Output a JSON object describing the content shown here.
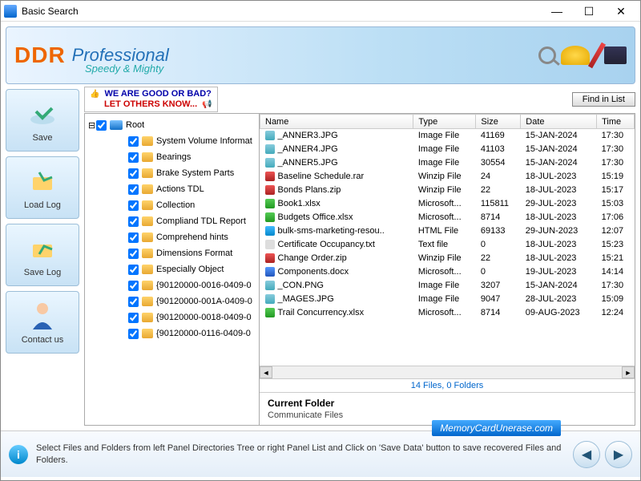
{
  "title": "Basic Search",
  "banner": {
    "brand": "DDR",
    "pro": "Professional",
    "tagline": "Speedy & Mighty"
  },
  "sidebar": [
    {
      "label": "Save"
    },
    {
      "label": "Load Log"
    },
    {
      "label": "Save Log"
    },
    {
      "label": "Contact us"
    }
  ],
  "feedback": {
    "line1": "WE ARE GOOD OR BAD?",
    "line2": "LET OTHERS KNOW..."
  },
  "find_btn": "Find in List",
  "tree": {
    "root": "Root",
    "items": [
      "System Volume Informat",
      "Bearings",
      "Brake System Parts",
      "Actions TDL",
      "Collection",
      "Compliand TDL Report",
      "Comprehend hints",
      "Dimensions Format",
      "Especially Object",
      "{90120000-0016-0409-0",
      "{90120000-001A-0409-0",
      "{90120000-0018-0409-0",
      "{90120000-0116-0409-0"
    ]
  },
  "columns": [
    "Name",
    "Type",
    "Size",
    "Date",
    "Time"
  ],
  "files": [
    {
      "ic": "img",
      "name": "_ANNER3.JPG",
      "type": "Image File",
      "size": "41169",
      "date": "15-JAN-2024",
      "time": "17:30"
    },
    {
      "ic": "img",
      "name": "_ANNER4.JPG",
      "type": "Image File",
      "size": "41103",
      "date": "15-JAN-2024",
      "time": "17:30"
    },
    {
      "ic": "img",
      "name": "_ANNER5.JPG",
      "type": "Image File",
      "size": "30554",
      "date": "15-JAN-2024",
      "time": "17:30"
    },
    {
      "ic": "rar",
      "name": "Baseline Schedule.rar",
      "type": "Winzip File",
      "size": "24",
      "date": "18-JUL-2023",
      "time": "15:19"
    },
    {
      "ic": "zip",
      "name": "Bonds Plans.zip",
      "type": "Winzip File",
      "size": "22",
      "date": "18-JUL-2023",
      "time": "15:17"
    },
    {
      "ic": "xls",
      "name": "Book1.xlsx",
      "type": "Microsoft...",
      "size": "115811",
      "date": "29-JUL-2023",
      "time": "15:03"
    },
    {
      "ic": "xls",
      "name": "Budgets Office.xlsx",
      "type": "Microsoft...",
      "size": "8714",
      "date": "18-JUL-2023",
      "time": "17:06"
    },
    {
      "ic": "html",
      "name": "bulk-sms-marketing-resou..",
      "type": "HTML File",
      "size": "69133",
      "date": "29-JUN-2023",
      "time": "12:07"
    },
    {
      "ic": "txt",
      "name": "Certificate Occupancy.txt",
      "type": "Text file",
      "size": "0",
      "date": "18-JUL-2023",
      "time": "15:23"
    },
    {
      "ic": "zip",
      "name": "Change Order.zip",
      "type": "Winzip File",
      "size": "22",
      "date": "18-JUL-2023",
      "time": "15:21"
    },
    {
      "ic": "doc",
      "name": "Components.docx",
      "type": "Microsoft...",
      "size": "0",
      "date": "19-JUL-2023",
      "time": "14:14"
    },
    {
      "ic": "img",
      "name": "_CON.PNG",
      "type": "Image File",
      "size": "3207",
      "date": "15-JAN-2024",
      "time": "17:30"
    },
    {
      "ic": "img",
      "name": "_MAGES.JPG",
      "type": "Image File",
      "size": "9047",
      "date": "28-JUL-2023",
      "time": "15:09"
    },
    {
      "ic": "xls",
      "name": "Trail Concurrency.xlsx",
      "type": "Microsoft...",
      "size": "8714",
      "date": "09-AUG-2023",
      "time": "12:24"
    }
  ],
  "summary": "14 Files, 0 Folders",
  "current_folder": {
    "label": "Current Folder",
    "value": "Communicate Files"
  },
  "footer_msg": "Select Files and Folders from left Panel Directories Tree or right Panel List and Click on 'Save Data' button to save recovered Files and Folders.",
  "memcard": "MemoryCardUnerase.com"
}
